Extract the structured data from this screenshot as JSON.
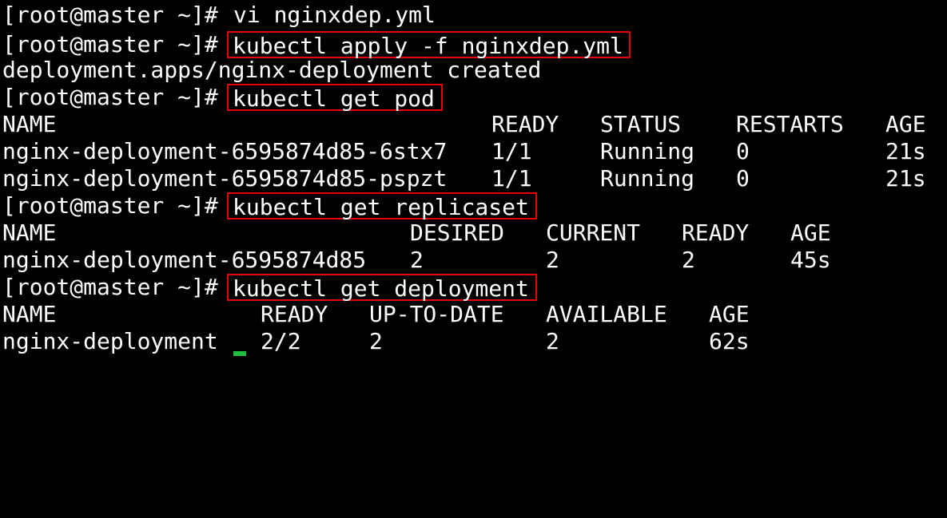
{
  "prompt": "[root@master ~]#",
  "lines": {
    "cmd_vi": "vi nginxdep.yml",
    "cmd_apply": "kubectl apply -f nginxdep.yml",
    "apply_output": "deployment.apps/nginx-deployment created",
    "cmd_get_pod": "kubectl get pod",
    "cmd_get_replicaset": "kubectl get replicaset",
    "cmd_get_deployment": "kubectl get deployment"
  },
  "pods": {
    "headers": [
      "NAME",
      "READY",
      "STATUS",
      "RESTARTS",
      "AGE"
    ],
    "rows": [
      [
        "nginx-deployment-6595874d85-6stx7",
        "1/1",
        "Running",
        "0",
        "21s"
      ],
      [
        "nginx-deployment-6595874d85-pspzt",
        "1/1",
        "Running",
        "0",
        "21s"
      ]
    ]
  },
  "replicasets": {
    "headers": [
      "NAME",
      "DESIRED",
      "CURRENT",
      "READY",
      "AGE"
    ],
    "rows": [
      [
        "nginx-deployment-6595874d85",
        "2",
        "2",
        "2",
        "45s"
      ]
    ]
  },
  "deployments": {
    "headers": [
      "NAME",
      "READY",
      "UP-TO-DATE",
      "AVAILABLE",
      "AGE"
    ],
    "rows": [
      [
        "nginx-deployment",
        "2/2",
        "2",
        "2",
        "62s"
      ]
    ]
  },
  "colors": {
    "background": "#000000",
    "text": "#ffffff",
    "highlight_border": "#e60000",
    "cursor": "#1fbf3f"
  }
}
